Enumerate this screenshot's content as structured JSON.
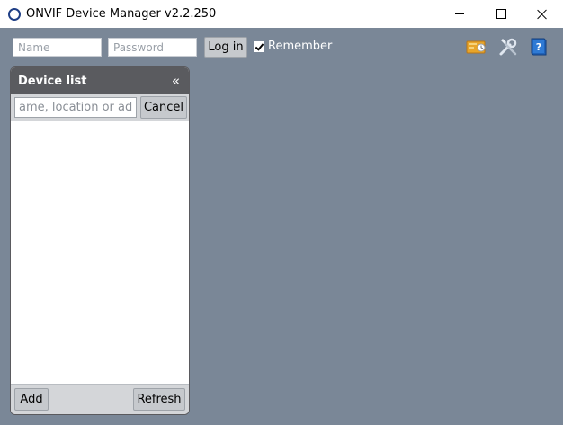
{
  "window": {
    "title": "ONVIF Device Manager v2.2.250",
    "app_icon": "circle-icon",
    "controls": {
      "minimize_icon": "minimize-icon",
      "maximize_icon": "maximize-icon",
      "close_icon": "close-icon"
    }
  },
  "login": {
    "name_placeholder": "Name",
    "password_placeholder": "Password",
    "login_label": "Log in",
    "remember_label": "Remember",
    "remember_checked": true
  },
  "toolbar": {
    "icons": [
      "about-icon",
      "settings-icon",
      "help-icon"
    ]
  },
  "device_list": {
    "title": "Device list",
    "collapse_glyph": "«",
    "search_placeholder": "ame, location or address",
    "cancel_label": "Cancel",
    "items": [],
    "add_label": "Add",
    "refresh_label": "Refresh"
  },
  "colors": {
    "workspace": "#7a8797",
    "panel_header": "#5a5b5f",
    "button": "#c6c9cd"
  }
}
